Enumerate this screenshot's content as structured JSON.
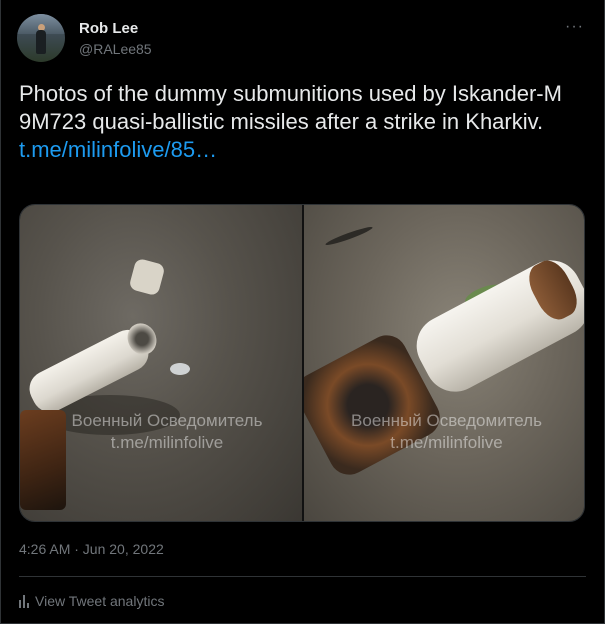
{
  "author": {
    "name": "Rob Lee",
    "handle": "@RALee85"
  },
  "menu": {
    "more_label": "···"
  },
  "tweet": {
    "text": "Photos of the dummy submunitions used by Iskander-M 9M723 quasi-ballistic missiles after a strike in Kharkiv.",
    "link": "t.me/milinfolive/85…",
    "timestamp": "4:26 AM · Jun 20, 2022"
  },
  "media": {
    "watermark_line1": "Военный Осведомитель",
    "watermark_line2": "t.me/milinfolive"
  },
  "footer": {
    "analytics_label": "View Tweet analytics"
  },
  "colors": {
    "background": "#000000",
    "text": "#e7e9ea",
    "secondary": "#71767b",
    "link": "#1d9bf0",
    "border": "#2f3336"
  }
}
